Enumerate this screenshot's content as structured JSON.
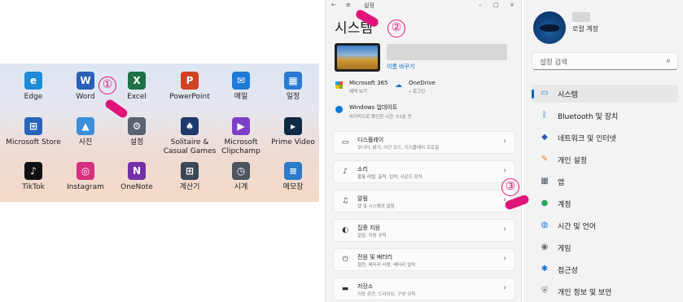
{
  "start_menu": {
    "apps": [
      {
        "label": "Edge",
        "icon": "edge-icon",
        "color": "#1e8bd4"
      },
      {
        "label": "Word",
        "icon": "word-icon",
        "color": "#2b5fb8"
      },
      {
        "label": "Excel",
        "icon": "excel-icon",
        "color": "#1e7145"
      },
      {
        "label": "PowerPoint",
        "icon": "powerpoint-icon",
        "color": "#d04423"
      },
      {
        "label": "메일",
        "icon": "mail-icon",
        "color": "#1f7ad6"
      },
      {
        "label": "일정",
        "icon": "calendar-icon",
        "color": "#2a79d4"
      },
      {
        "label": "Microsoft Store",
        "icon": "store-icon",
        "color": "#2a64b8"
      },
      {
        "label": "사진",
        "icon": "photos-icon",
        "color": "#3a8fd8"
      },
      {
        "label": "설정",
        "icon": "settings-gear-icon",
        "color": "#5a6470"
      },
      {
        "label": "Solitaire & Casual Games",
        "icon": "solitaire-icon",
        "color": "#1c3a6b"
      },
      {
        "label": "Microsoft Clipchamp",
        "icon": "clipchamp-icon",
        "color": "#7b3fc8"
      },
      {
        "label": "Prime Video",
        "icon": "prime-video-icon",
        "color": "#0f2a44"
      },
      {
        "label": "TikTok",
        "icon": "tiktok-icon",
        "color": "#111111"
      },
      {
        "label": "Instagram",
        "icon": "instagram-icon",
        "color": "#d6317f"
      },
      {
        "label": "OneNote",
        "icon": "onenote-icon",
        "color": "#7430a8"
      },
      {
        "label": "계산기",
        "icon": "calculator-icon",
        "color": "#3a4756"
      },
      {
        "label": "시계",
        "icon": "clock-icon",
        "color": "#4a5560"
      },
      {
        "label": "메모장",
        "icon": "notepad-icon",
        "color": "#2b7cc9"
      }
    ]
  },
  "system_window": {
    "app_title": "설정",
    "page_title": "시스템",
    "rename_link": "이름 바꾸기",
    "microsoft365": {
      "title": "Microsoft 365",
      "subtitle": "혜택 보기"
    },
    "onedrive": {
      "title": "OneDrive",
      "subtitle": "• 로그인"
    },
    "windows_update": {
      "title": "Windows 업데이트",
      "subtitle": "마지막으로 확인한 시간: 51분 전"
    },
    "items": [
      {
        "title": "디스플레이",
        "subtitle": "모니터, 밝기, 야간 모드, 디스플레이 프로필",
        "icon": "display-icon"
      },
      {
        "title": "소리",
        "subtitle": "볼륨 레벨, 출력, 입력, 사운드 장치",
        "icon": "speaker-icon"
      },
      {
        "title": "알림",
        "subtitle": "앱 및 시스템의 알림",
        "icon": "bell-icon"
      },
      {
        "title": "집중 지원",
        "subtitle": "알림, 자동 규칙",
        "icon": "focus-moon-icon"
      },
      {
        "title": "전원 및 배터리",
        "subtitle": "절전, 배터리 사용, 배터리 절약",
        "icon": "power-icon"
      },
      {
        "title": "저장소",
        "subtitle": "저장 공간, 드라이브, 구성 규칙",
        "icon": "storage-icon"
      }
    ]
  },
  "nav_window": {
    "account_type": "로컬 계정",
    "search_placeholder": "설정 검색",
    "selected_index": 0,
    "items": [
      {
        "label": "시스템",
        "icon": "monitor-icon",
        "color": "#1a8ad4"
      },
      {
        "label": "Bluetooth 및 장치",
        "icon": "bluetooth-icon",
        "color": "#1f6fc9"
      },
      {
        "label": "네트워크 및 인터넷",
        "icon": "network-icon",
        "color": "#2a5d9f"
      },
      {
        "label": "개인 설정",
        "icon": "brush-icon",
        "color": "#e08a2b"
      },
      {
        "label": "앱",
        "icon": "apps-icon",
        "color": "#4a5560"
      },
      {
        "label": "계정",
        "icon": "person-icon",
        "color": "#2ba860"
      },
      {
        "label": "시간 및 언어",
        "icon": "globe-clock-icon",
        "color": "#1f7ad6"
      },
      {
        "label": "게임",
        "icon": "gamepad-icon",
        "color": "#6a6a6a"
      },
      {
        "label": "접근성",
        "icon": "accessibility-icon",
        "color": "#1a6ec9"
      },
      {
        "label": "개인 정보 및 보안",
        "icon": "shield-icon",
        "color": "#6a6a6a"
      }
    ]
  },
  "annotations": {
    "step1": "①",
    "step2": "②",
    "step3": "③"
  }
}
